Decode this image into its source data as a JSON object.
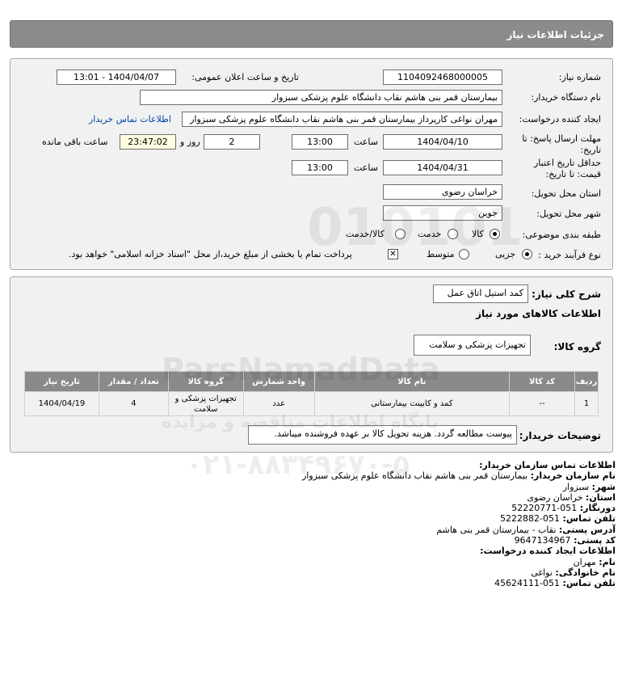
{
  "header": {
    "title": "جزئیات اطلاعات نیاز"
  },
  "form": {
    "need_number_label": "شماره نیاز:",
    "need_number": "1104092468000005",
    "announce_label": "تاریخ و ساعت اعلان عمومی:",
    "announce_value": "1404/04/07 - 13:01",
    "buyer_org_label": "نام دستگاه خریدار:",
    "buyer_org": "بیمارستان قمر بنی هاشم نقاب   دانشگاه علوم پزشکی سبزوار",
    "creator_label": "ایجاد کننده درخواست:",
    "creator": "مهران نواغی کارپرداز بیمارستان قمر بنی هاشم نقاب   دانشگاه علوم پزشکی سبزوار",
    "buyer_contact_link": "اطلاعات تماس خریدار",
    "reply_deadline_label": "مهلت ارسال پاسخ: تا تاریخ:",
    "reply_date": "1404/04/10",
    "time_label": "ساعت",
    "reply_time": "13:00",
    "days_value": "2",
    "days_label": "روز و",
    "remaining_time": "23:47:02",
    "remaining_label": "ساعت باقی مانده",
    "min_validity_label": "حداقل تاریخ اعتبار قیمت: تا تاریخ:",
    "validity_date": "1404/04/31",
    "validity_time": "13:00",
    "province_label": "استان محل تحویل:",
    "province": "خراسان رضوی",
    "city_label": "شهر محل تحویل:",
    "city": "جوین",
    "category_label": "طبقه بندی موضوعی:",
    "cat_goods": "کالا",
    "cat_service": "خدمت",
    "cat_goods_service": "کالا/خدمت",
    "process_label": "نوع فرآیند خرید :",
    "proc_minor": "جزیی",
    "proc_medium": "متوسط",
    "payment_note": "پرداخت تمام یا بخشی از مبلغ خرید،از محل \"اسناد خزانه اسلامی\" خواهد بود."
  },
  "summary": {
    "general_desc_label": "شرح کلی نیاز:",
    "general_desc": "کمد استیل اتاق عمل",
    "goods_info_title": "اطلاعات کالاهای مورد نیاز",
    "goods_group_label": "گروه کالا:",
    "goods_group": "تجهیزات پزشکی و سلامت",
    "buyer_notes_label": "توضیحات خریدار:",
    "buyer_notes": "پیوست مطالعه گردد. هزینه تحویل کالا بر عهده فروشنده میباشد."
  },
  "table": {
    "headers": [
      "ردیف",
      "کد کالا",
      "نام کالا",
      "واحد شمارش",
      "گروه کالا",
      "تعداد / مقدار",
      "تاریخ نیاز"
    ],
    "rows": [
      [
        "1",
        "--",
        "کمد و کابینت بیمارستانی",
        "عدد",
        "تجهیزات پزشکی و سلامت",
        "4",
        "1404/04/19"
      ]
    ]
  },
  "contact": {
    "title": "اطلاعات تماس سازمان خریدار:",
    "org_name_label": "نام سازمان خریدار:",
    "org_name": "بیمارستان قمر بنی هاشم نقاب دانشگاه علوم پزشکی سبزوار",
    "city_label": "شهر:",
    "city": "سبزوار",
    "province_label": "استان:",
    "province": "خراسان رضوی",
    "fax_label": "دورنگار:",
    "fax": "051-52220771",
    "phone_label": "تلفن تماس:",
    "phone": "051-5222882",
    "address_label": "آدرس پستی:",
    "address": "نقاب - بیمارستان قمر بنی هاشم",
    "postal_label": "کد پستی:",
    "postal": "9647134967",
    "creator_title": "اطلاعات ایجاد کننده درخواست:",
    "first_name_label": "نام:",
    "first_name": "مهران",
    "last_name_label": "نام خانوادگی:",
    "last_name": "نواغی",
    "creator_phone_label": "تلفن تماس:",
    "creator_phone": "051-45624111"
  },
  "watermark": {
    "brand": "ParsNamadData",
    "tagline": "پایگاه اطلاعات مناقصه و مزایده",
    "phone": "۰۲۱-۸۸۳۴۹۶۷۰-۵",
    "number": "010101"
  }
}
